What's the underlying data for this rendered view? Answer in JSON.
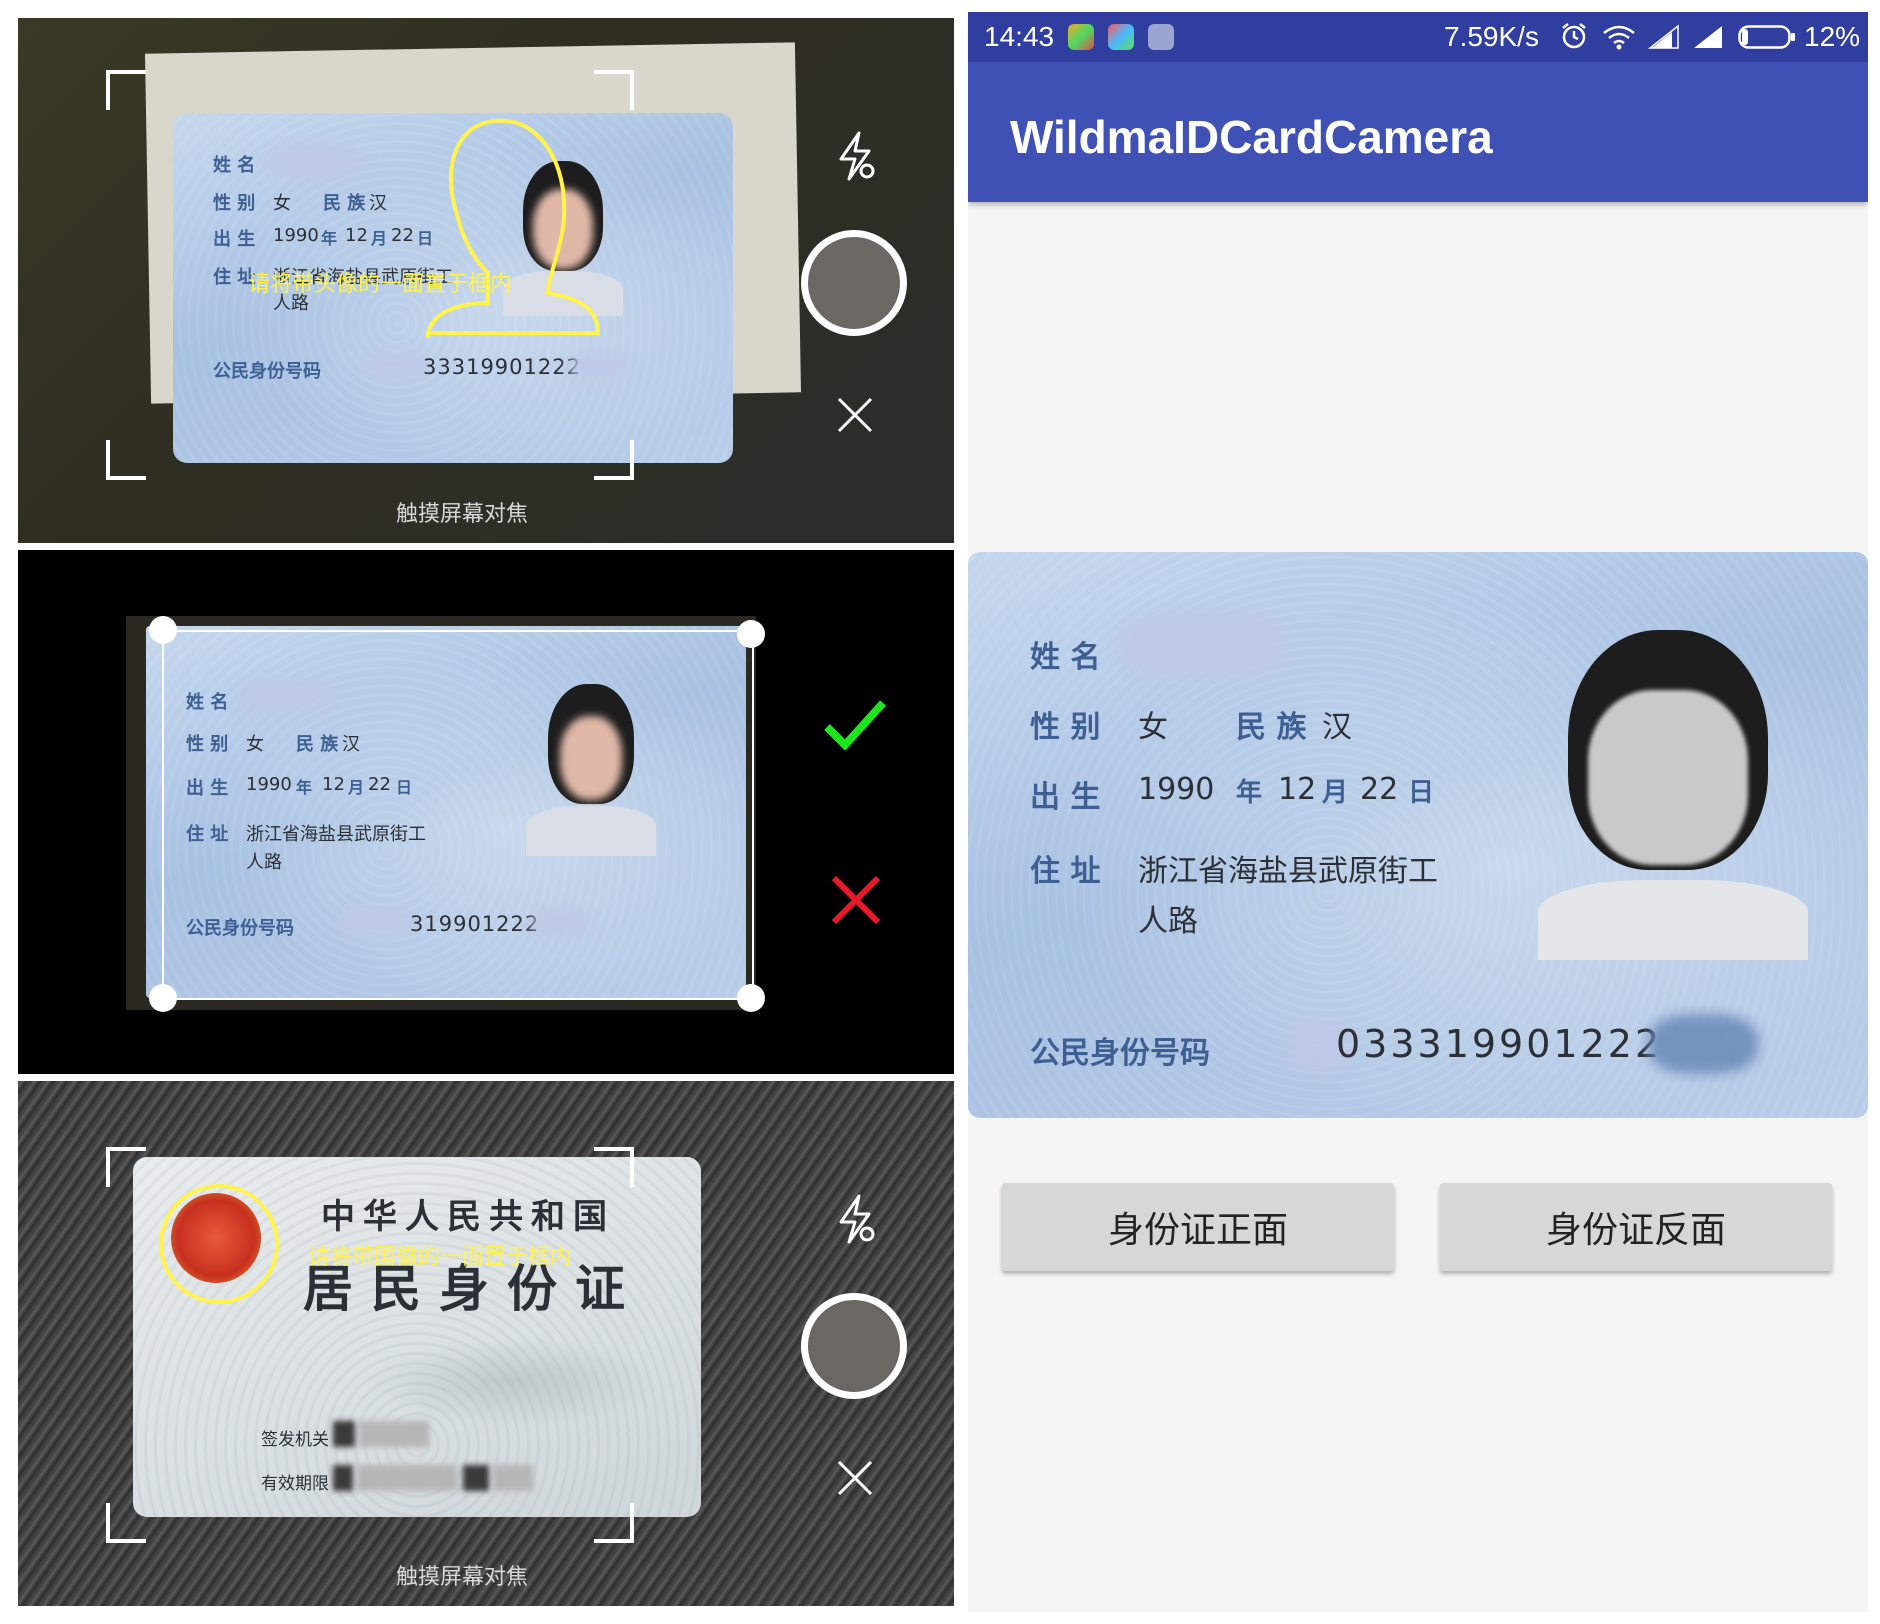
{
  "app": {
    "title": "WildmaIDCardCamera"
  },
  "status_bar": {
    "time": "14:43",
    "net_speed": "7.59K/s",
    "battery": "12%"
  },
  "buttons": {
    "front": "身份证正面",
    "back": "身份证反面"
  },
  "camera_front": {
    "hint": "请将带头像的一面置于框内",
    "focus_text": "触摸屏幕对焦",
    "icons": [
      "flash-off-icon",
      "shutter-button",
      "close-icon"
    ]
  },
  "crop_confirm": {
    "icons": [
      "confirm-check-icon",
      "cancel-x-icon"
    ]
  },
  "camera_back": {
    "hint": "请将带国徽的一面置于框内",
    "focus_text": "触摸屏幕对焦",
    "icons": [
      "flash-off-icon",
      "shutter-button",
      "close-icon"
    ]
  },
  "card_front": {
    "name_label": "姓 名",
    "sex_label": "性 别",
    "sex_value": "女",
    "ethnic_label": "民 族",
    "ethnic_value": "汉",
    "birth_label": "出 生",
    "birth_year": "1990",
    "year_char": "年",
    "birth_month": "12",
    "month_char": "月",
    "birth_day": "22",
    "day_char": "日",
    "address_label": "住 址",
    "address_line1": "浙江省海盐县武原街工",
    "address_line2": "人路",
    "id_label": "公民身份号码",
    "id_partial": "33319901222",
    "id_partial_crop": "319901222",
    "id_partial_preview": "033319901222"
  },
  "card_back": {
    "line1": "中华人民共和国",
    "line2": "居民身份证",
    "issuer_label": "签发机关",
    "validity_label": "有效期限"
  },
  "colors": {
    "primary": "#3f51b5",
    "primary_dark": "#303f9f",
    "hint_yellow": "#fff34c",
    "confirm_green": "#1ee61e",
    "cancel_red": "#e8192a",
    "button_grey": "#d6d7d7"
  }
}
